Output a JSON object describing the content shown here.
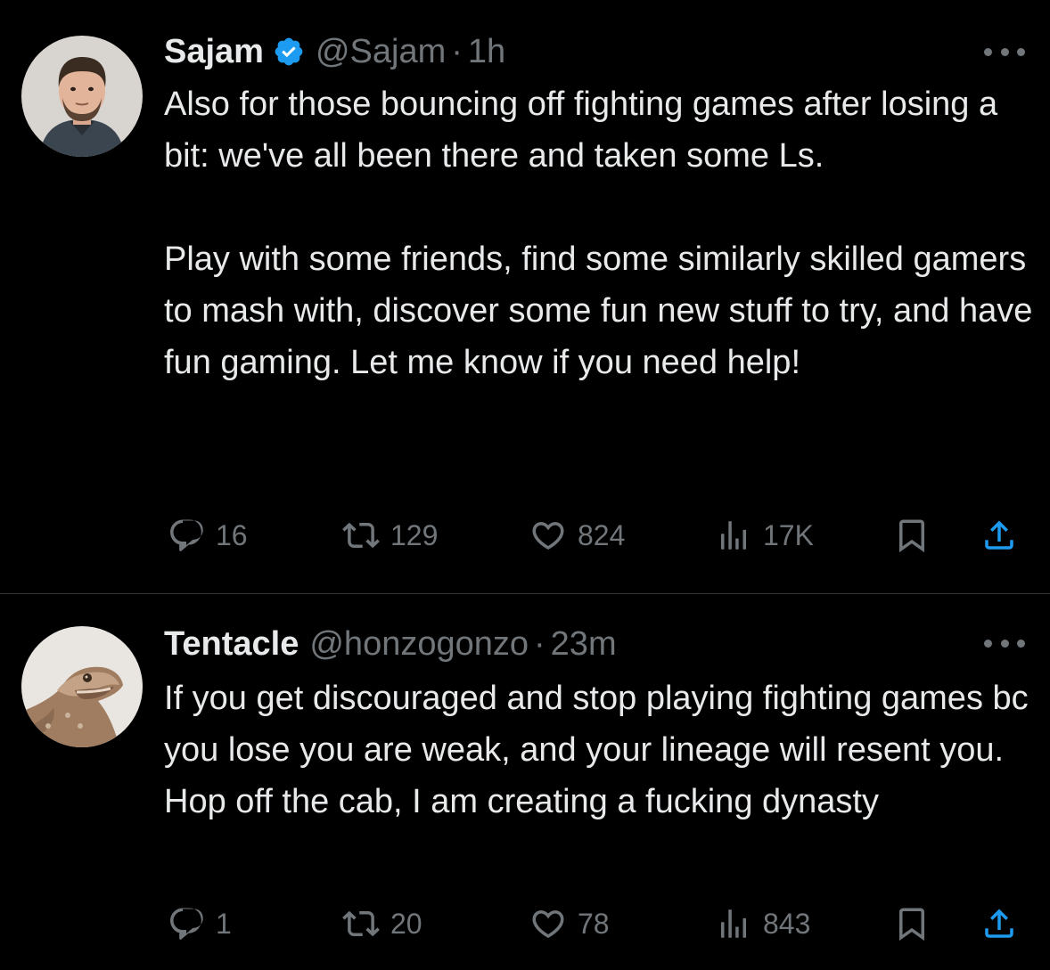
{
  "colors": {
    "background": "#000000",
    "text_primary": "#e7e9ea",
    "text_secondary": "#71767b",
    "verified_blue": "#1d9bf0",
    "divider": "#2f3336"
  },
  "tweets": [
    {
      "display_name": "Sajam",
      "verified": true,
      "handle": "@Sajam",
      "separator": "·",
      "time": "1h",
      "avatar_icon": "avatar-man-photo",
      "paragraphs": [
        "Also for those bouncing off fighting games after losing a bit: we've all been there and taken some Ls.",
        "Play with some friends, find some similarly skilled gamers to mash with, discover some fun new stuff to try, and have fun gaming. Let me know if you need help!"
      ],
      "actions": {
        "replies": "16",
        "retweets": "129",
        "likes": "824",
        "views": "17K"
      }
    },
    {
      "display_name": "Tentacle",
      "verified": false,
      "handle": "@honzogonzo",
      "separator": "·",
      "time": "23m",
      "avatar_icon": "avatar-lizard-photo",
      "paragraphs": [
        "If you get discouraged and stop playing fighting games bc you lose you are weak, and your lineage will resent you. Hop off the cab, I am creating a fucking dynasty"
      ],
      "actions": {
        "replies": "1",
        "retweets": "20",
        "likes": "78",
        "views": "843"
      }
    }
  ]
}
